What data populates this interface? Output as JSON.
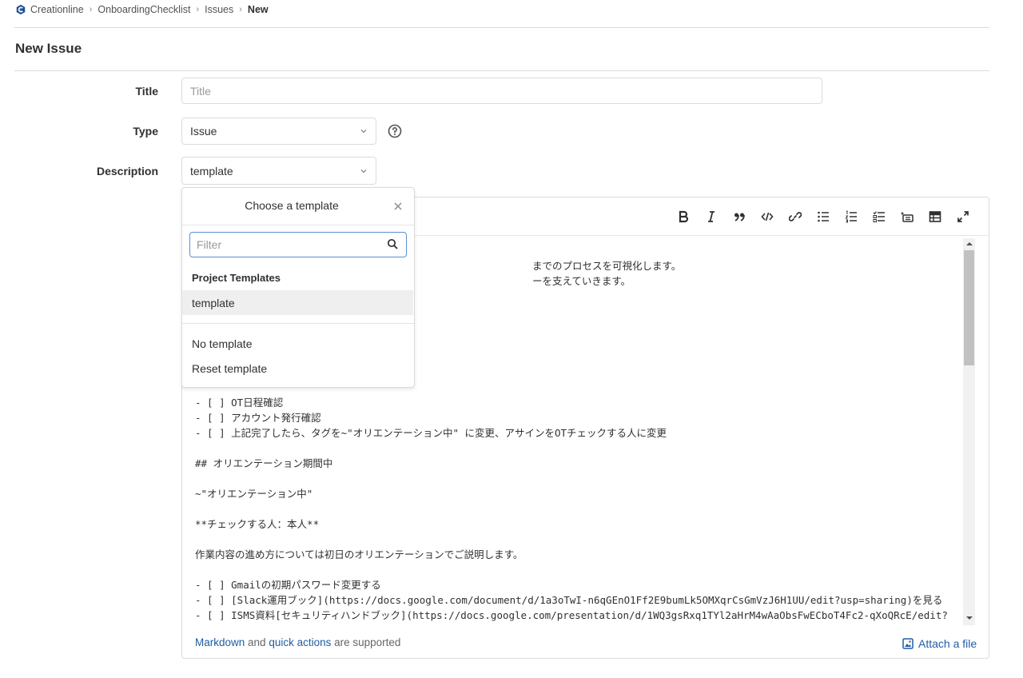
{
  "breadcrumb": {
    "items": [
      "Creationline",
      "OnboardingChecklist",
      "Issues"
    ],
    "current": "New",
    "separator": "›"
  },
  "page": {
    "title": "New Issue"
  },
  "form": {
    "title_label": "Title",
    "title_placeholder": "Title",
    "type_label": "Type",
    "type_value": "Issue",
    "description_label": "Description",
    "description_value": "template"
  },
  "editor": {
    "lines": [
      {
        "row": 1,
        "text": "までのプロセスを可視化します。",
        "indent": 422
      },
      {
        "row": 2,
        "text": "ーを支えていきます。",
        "indent": 422
      },
      {
        "row": 10,
        "text": "- [ ] OT日程確認",
        "indent": 0
      },
      {
        "row": 11,
        "text": "- [ ] アカウント発行確認",
        "indent": 0
      },
      {
        "row": 12,
        "text": "- [ ] 上記完了したら、タグを~\"オリエンテーション中\" に変更、アサインをOTチェックする人に変更",
        "indent": 0
      },
      {
        "row": 14,
        "text": "## オリエンテーション期間中",
        "indent": 0
      },
      {
        "row": 16,
        "text": "~\"オリエンテーション中\"",
        "indent": 0
      },
      {
        "row": 18,
        "text": "**チェックする人：本人**",
        "indent": 0
      },
      {
        "row": 20,
        "text": "作業内容の進め方については初日のオリエンテーションでご説明します。",
        "indent": 0
      },
      {
        "row": 22,
        "text": "- [ ] Gmailの初期パスワード変更する",
        "indent": 0
      },
      {
        "row": 23,
        "text": "- [ ] [Slack運用ブック](https://docs.google.com/document/d/1a3oTwI-n6qGEnO1Ff2E9bumLk5OMXqrCsGmVzJ6H1UU/edit?usp=sharing)を見る",
        "indent": 0
      },
      {
        "row": 24,
        "text": "- [ ] ISMS資料[セキュリティハンドブック](https://docs.google.com/presentation/d/1WQ3gsRxq1TYl2aHrM4wAaObsFwECboT4Fc2-qXoQRcE/edit?",
        "indent": 0
      }
    ],
    "footer_link_markdown": "Markdown",
    "footer_and": " and ",
    "footer_link_quick": "quick actions",
    "footer_suffix": " are supported",
    "attach_label": "Attach a file"
  },
  "toolbar": {
    "icons": [
      "bold-icon",
      "italic-icon",
      "quote-icon",
      "code-icon",
      "link-icon",
      "bullet-list-icon",
      "numbered-list-icon",
      "task-list-icon",
      "collapsible-icon",
      "table-icon",
      "fullscreen-icon"
    ]
  },
  "template_dropdown": {
    "title": "Choose a template",
    "filter_placeholder": "Filter",
    "section_header": "Project Templates",
    "items": [
      "template"
    ],
    "extra_items": [
      "No template",
      "Reset template"
    ]
  },
  "colors": {
    "link": "#1f5da5",
    "border": "#dbdbdb",
    "active_bg": "#efefef"
  }
}
